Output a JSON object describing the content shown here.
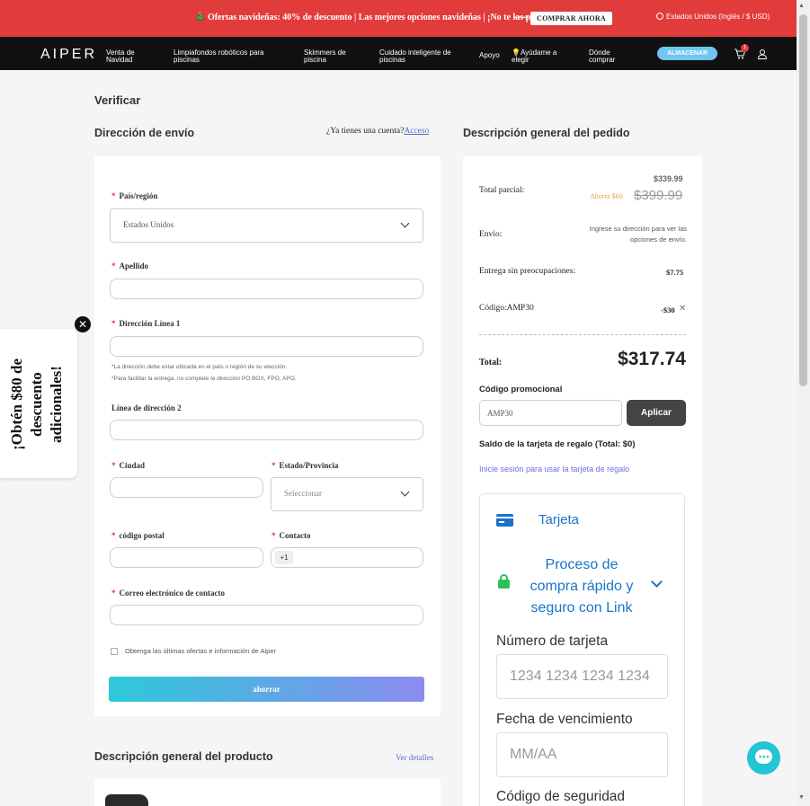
{
  "promo": {
    "text": "🎄 Ofertas navideñas: 40% de descuento | Las mejores opciones navideñas | ¡No te las pierdas!",
    "arrow": "⟶",
    "button": "COMPRAR AHORA",
    "region": "Estados Unidos (Inglés / $ USD)"
  },
  "nav": {
    "logo": "AIPER",
    "items": [
      "Venta de Navidad",
      "Limpiafondos robóticos para piscinas",
      "Skimmers de piscina",
      "Cuidado inteligente de piscinas",
      "Apoyo",
      "💡Ayúdame a elegir",
      "Dónde comprar"
    ],
    "store": "ALMACENAR",
    "cart_count": "1"
  },
  "page": {
    "title": "Verificar",
    "shipping_title": "Dirección de envío",
    "have_account": "¿Ya tienes una cuenta?",
    "login": "Acceso",
    "order_title": "Descripción general del pedido"
  },
  "form": {
    "country_label": "País/región",
    "country_value": "Estados Unidos",
    "lastname_label": "Apellido",
    "address1_label": "Dirección Línea 1",
    "note1": "*La dirección debe estar ubicada en el país o región de su elección.",
    "note2": "*Para facilitar la entrega, no complete la dirección PO BOX, FPO, APO.",
    "address2_label": "Línea de dirección 2",
    "city_label": "Ciudad",
    "state_label": "Estado/Provincia",
    "state_placeholder": "Seleccionar",
    "zip_label": "código postal",
    "contact_label": "Contacto",
    "phone_prefix": "+1",
    "email_label": "Correo electrónico de contacto",
    "offers_label": "Obtenga las últimas ofertas e información de Aiper",
    "submit": "ahorrar"
  },
  "popup": {
    "text": "¡Obtén $80 de descuento adicionales!",
    "close": "✕"
  },
  "order": {
    "subtotal_label": "Total parcial:",
    "subtotal_new": "$339.99",
    "savings": "Ahorra $60",
    "subtotal_old": "$399.99",
    "shipping_label": "Envío:",
    "shipping_note": "Ingrese su dirección para ver las opciones de envío.",
    "protection_label": "Entrega sin preocupaciones:",
    "protection_value": "$7.75",
    "code_label": "Código:AMP30",
    "code_value": "-$30",
    "code_remove": "✕",
    "total_label": "Total:",
    "total_value": "$317.74",
    "promo_label": "Código promocional",
    "promo_value": "AMP30",
    "apply": "Aplicar",
    "gift_balance": "Saldo de la tarjeta de regalo (Total: $0)",
    "gift_link": "Inicie sesión para usar la tarjeta de regalo"
  },
  "payment": {
    "card_tab": "Tarjeta",
    "link_text": "Proceso de compra rápido y seguro con Link",
    "card_number_label": "Número de tarjeta",
    "card_number_placeholder": "1234 1234 1234 1234",
    "expiry_label": "Fecha de vencimiento",
    "expiry_placeholder": "MM/AA",
    "cvc_label": "Código de seguridad"
  },
  "product": {
    "title": "Descripción general del producto",
    "details": "Ver detalles"
  },
  "colors": {
    "promo_bg": "#e23b3b",
    "nav_bg": "#111111",
    "accent_blue": "#1a73c9",
    "link_purple": "#5b6ccf",
    "chat": "#22c4d6"
  }
}
